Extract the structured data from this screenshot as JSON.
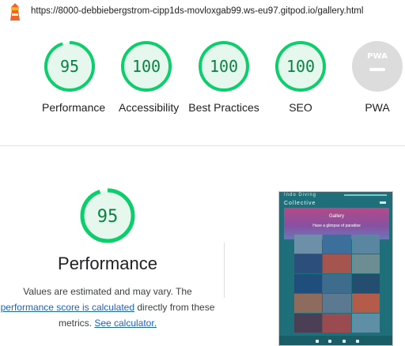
{
  "url": "https://8000-debbiebergstrom-cipp1ds-movloxgab99.ws-eu97.gitpod.io/gallery.html",
  "gauges": [
    {
      "score": "95",
      "label": "Performance",
      "value": 0.95
    },
    {
      "score": "100",
      "label": "Accessibility",
      "value": 1.0
    },
    {
      "score": "100",
      "label": "Best Practices",
      "value": 1.0
    },
    {
      "score": "100",
      "label": "SEO",
      "value": 1.0
    },
    {
      "score": "PWA",
      "label": "PWA",
      "value": null
    }
  ],
  "performance": {
    "score": "95",
    "value": 0.95,
    "title": "Performance",
    "desc_prefix": "Values are estimated and may vary. The",
    "link1": "performance score is calculated",
    "desc_mid": "directly from these metrics.",
    "link2": "See calculator."
  },
  "thumbnail": {
    "brand_line1": "Indo Diving",
    "brand_line2": "Collective",
    "hero_title": "Gallery",
    "hero_subtitle": "Have a glimpse of paradise"
  },
  "colors": {
    "pass": "#0cce6b",
    "pass_text": "#0b8043",
    "pass_bg": "#e6f8ee",
    "na": "#dcdcdc",
    "link": "#1a5fd6"
  }
}
